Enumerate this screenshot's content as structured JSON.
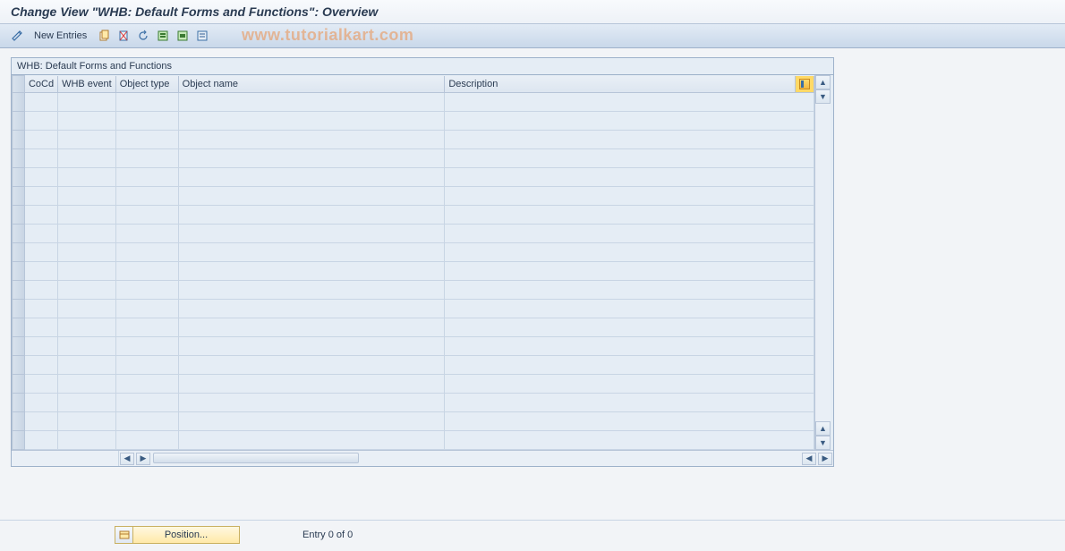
{
  "header": {
    "title": "Change View \"WHB: Default  Forms and Functions\": Overview"
  },
  "toolbar": {
    "new_entries_label": "New Entries"
  },
  "watermark": "www.tutorialkart.com",
  "table": {
    "title": "WHB: Default  Forms and Functions",
    "columns": {
      "cocd": "CoCd",
      "whb_event": "WHB event",
      "object_type": "Object type",
      "object_name": "Object name",
      "description": "Description"
    },
    "row_count": 19
  },
  "footer": {
    "position_label": "Position...",
    "entry_status": "Entry 0 of 0"
  }
}
